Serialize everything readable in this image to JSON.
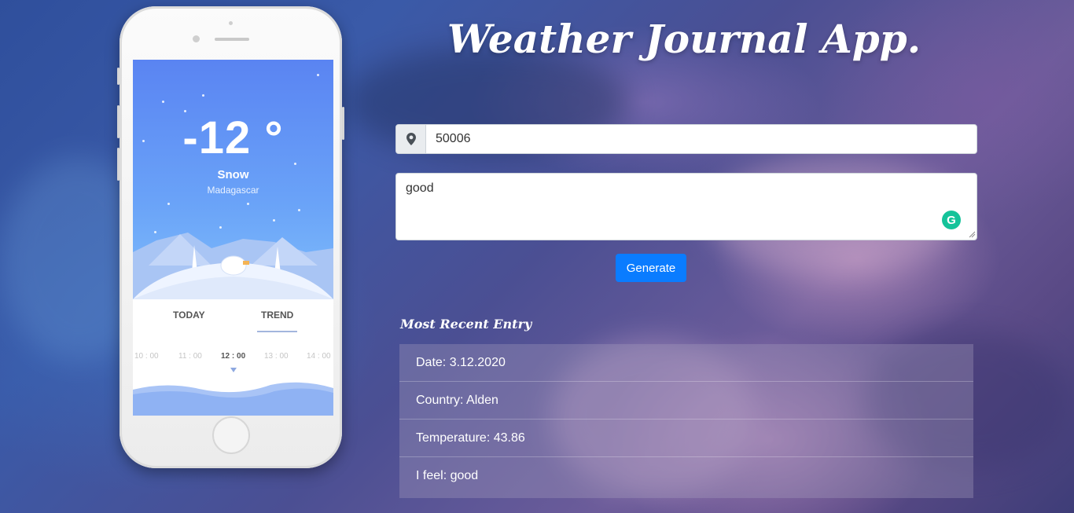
{
  "app": {
    "title": "Weather Journal App."
  },
  "phone": {
    "temperature": "-12 °",
    "condition": "Snow",
    "location": "Madagascar",
    "tabs": [
      "TODAY",
      "TREND"
    ],
    "times": [
      "10 : 00",
      "11 : 00",
      "12 : 00",
      "13 : 00",
      "14 : 00"
    ]
  },
  "form": {
    "zip_value": "50006",
    "zip_icon": "map-marker-icon",
    "feelings_value": "good",
    "generate_label": "Generate"
  },
  "recent": {
    "heading": "Most Recent Entry",
    "date": "Date: 3.12.2020",
    "country": "Country: Alden",
    "temperature": "Temperature: 43.86",
    "feel": "I feel: good"
  },
  "colors": {
    "button": "#0a7cff",
    "grammarly": "#15c39a",
    "sky_top": "#5a84f2"
  }
}
